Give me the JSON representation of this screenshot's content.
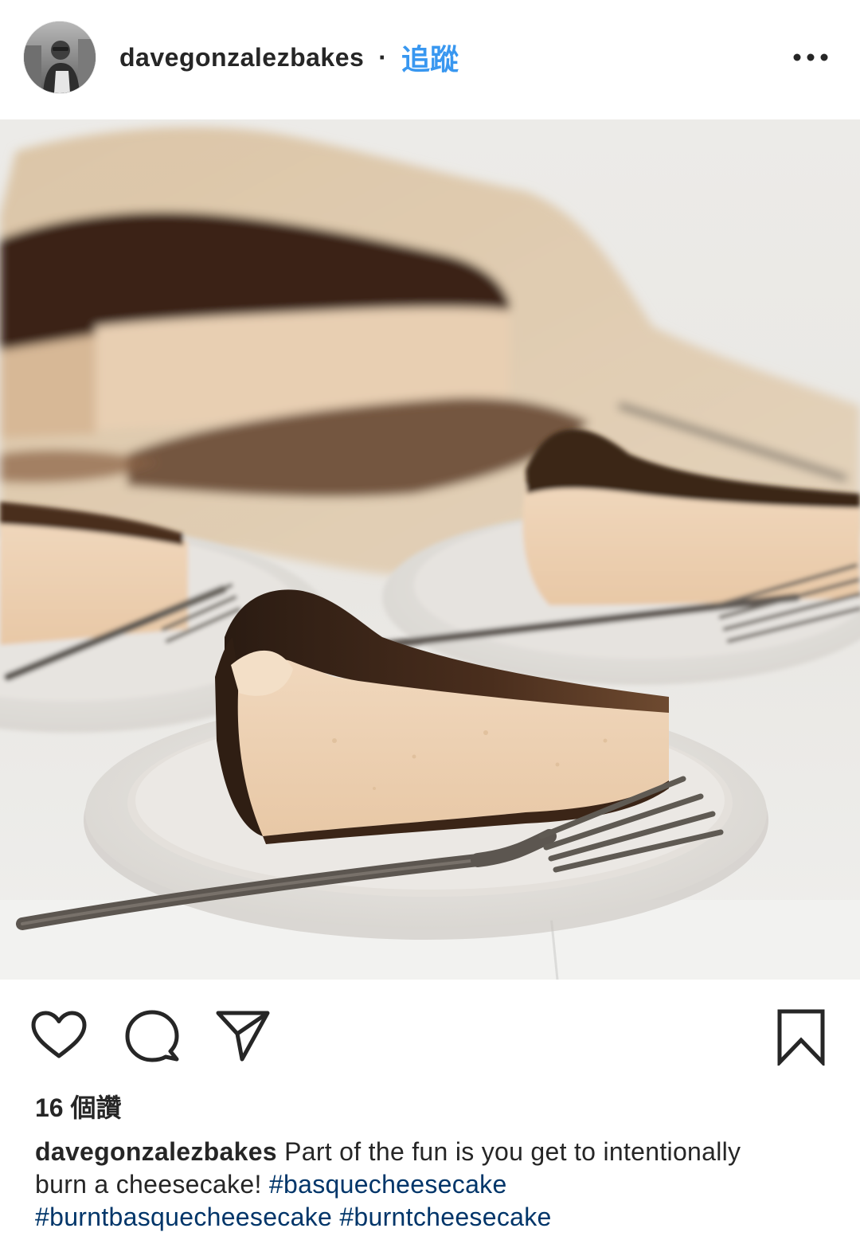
{
  "header": {
    "username": "davegonzalezbakes",
    "separator": "·",
    "follow_label": "追蹤",
    "more_icon": "ellipsis-icon",
    "avatar_icon": "profile-avatar"
  },
  "photo": {
    "subject_icon": "photo-basque-cheesecake"
  },
  "actions": {
    "like_icon": "heart-icon",
    "comment_icon": "comment-icon",
    "share_icon": "paper-plane-icon",
    "save_icon": "bookmark-icon"
  },
  "likes": {
    "text": "16 個讚"
  },
  "caption": {
    "username": "davegonzalezbakes",
    "text_line1": "Part of the fun is you get to intentionally burn a cheesecake!",
    "hashtags": [
      "#basquecheesecake",
      "#burntbasquecheesecake",
      "#burntcheesecake"
    ]
  },
  "colors": {
    "link_blue": "#3897f0",
    "hashtag_blue": "#003569",
    "text": "#262626"
  }
}
